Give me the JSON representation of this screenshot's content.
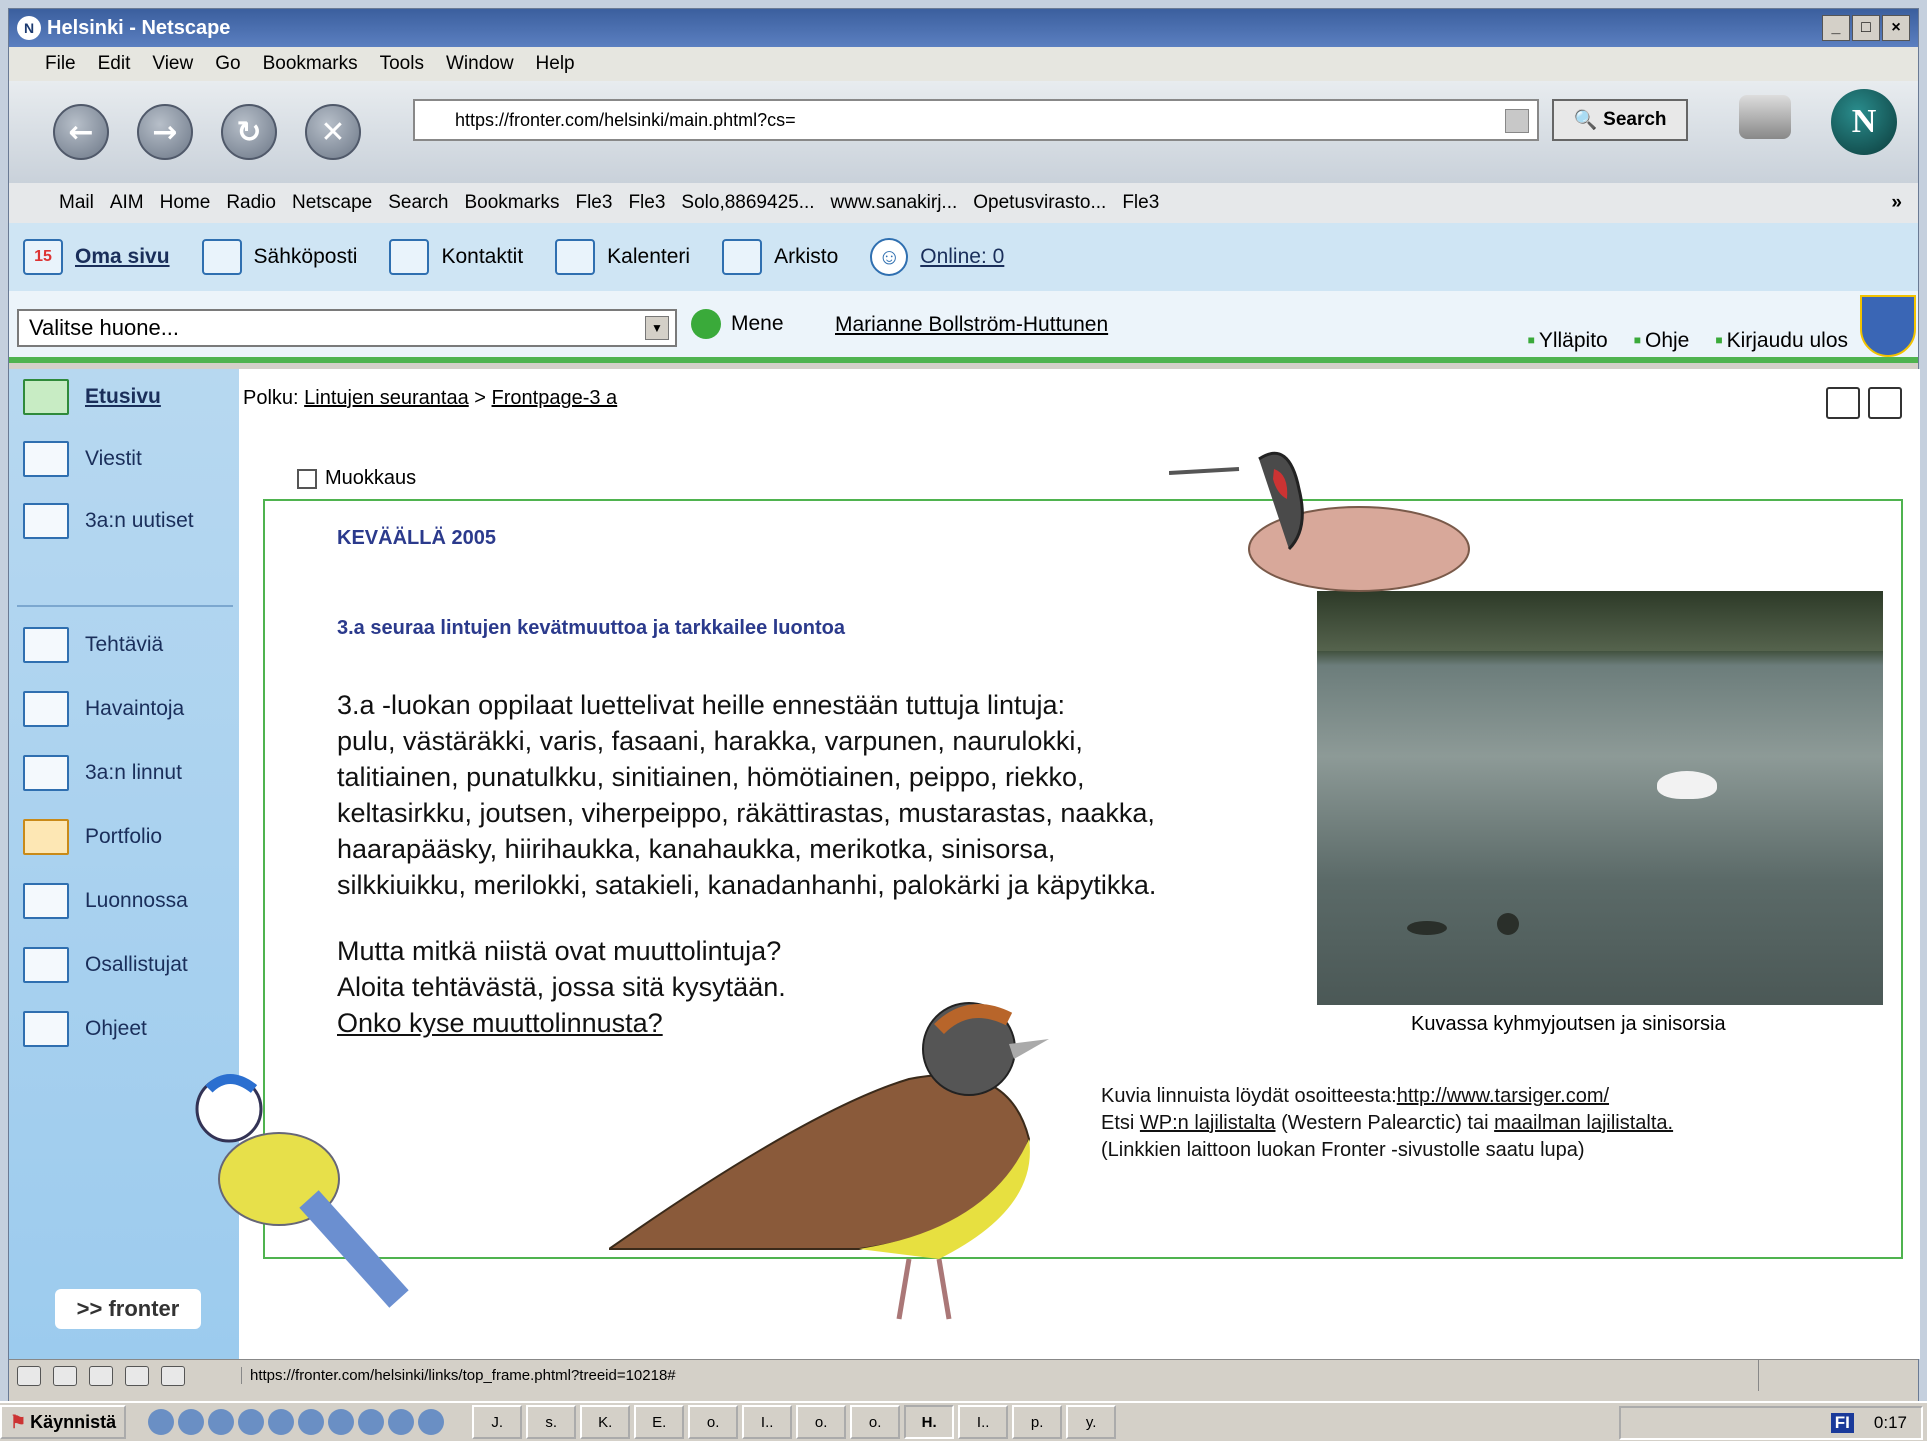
{
  "window": {
    "title": "Helsinki - Netscape"
  },
  "menu": [
    "File",
    "Edit",
    "View",
    "Go",
    "Bookmarks",
    "Tools",
    "Window",
    "Help"
  ],
  "nav": {
    "url": "https://fronter.com/helsinki/main.phtml?cs=",
    "search_label": "Search",
    "logo_letter": "N"
  },
  "bookmarks": [
    "Mail",
    "AIM",
    "Home",
    "Radio",
    "Netscape",
    "Search",
    "Bookmarks",
    "Fle3",
    "Fle3",
    "Solo,8869425...",
    "www.sanakirj...",
    "Opetusvirasto...",
    "Fle3"
  ],
  "fronter_bar": {
    "oma_sivu": "Oma sivu",
    "sahkoposti": "Sähköposti",
    "kontaktit": "Kontaktit",
    "kalenteri": "Kalenteri",
    "arkisto": "Arkisto",
    "online": "Online: 0",
    "calendar_day": "15"
  },
  "room_bar": {
    "room_placeholder": "Valitse huone...",
    "go_label": "Mene",
    "user": "Marianne Bollström-Huttunen",
    "yllapito": "Ylläpito",
    "ohje": "Ohje",
    "kirjaudu_ulos": "Kirjaudu ulos"
  },
  "sidebar": {
    "items": [
      "Etusivu",
      "Viestit",
      "3a:n uutiset",
      "Tehtäviä",
      "Havaintoja",
      "3a:n linnut",
      "Portfolio",
      "Luonnossa",
      "Osallistujat",
      "Ohjeet"
    ],
    "logo": ">> fronter"
  },
  "breadcrumb": {
    "label": "Polku:",
    "crumb1": "Lintujen seurantaa",
    "sep": ">",
    "crumb2": "Frontpage-3 a"
  },
  "page": {
    "edit_label": "Muokkaus",
    "heading": "KEVÄÄLLÄ 2005",
    "subheading": "3.a seuraa lintujen kevätmuuttoa ja tarkkailee luontoa",
    "body_lines": [
      "3.a -luokan oppilaat luettelivat heille ennestään tuttuja lintuja:",
      "pulu, västäräkki, varis, fasaani, harakka, varpunen, naurulokki,",
      "talitiainen, punatulkku, sinitiainen, hömötiainen, peippo, riekko,",
      "keltasirkku, joutsen, viherpeippo, räkättirastas, mustarastas, naakka,",
      "haarapääsky, hiirihaukka, kanahaukka, merikotka, sinisorsa,",
      "silkkiuikku, merilokki, satakieli, kanadanhanhi, palokärki ja käpytikka."
    ],
    "question1": "Mutta mitkä niistä ovat muuttolintuja?",
    "question2": "Aloita tehtävästä, jossa sitä kysytään.",
    "question_link": "Onko kyse muuttolinnusta?",
    "photo_caption": "Kuvassa kyhmyjoutsen ja sinisorsia",
    "info1_prefix": "Kuvia linnuista löydät osoitteesta:",
    "info1_link": "http://www.tarsiger.com/",
    "info2_prefix": "Etsi",
    "info2_link1": "WP:n lajilistalta",
    "info2_mid": "(Western Palearctic) tai",
    "info2_link2": "maailman lajilistalta.",
    "info3": "(Linkkien laittoon luokan Fronter -sivustolle saatu lupa)"
  },
  "status": {
    "url": "https://fronter.com/helsinki/links/top_frame.phtml?treeid=10218#"
  },
  "taskbar": {
    "start": "Käynnistä",
    "buttons": [
      "J.",
      "s.",
      "K.",
      "E.",
      "o.",
      "I..",
      "o.",
      "o.",
      "H.",
      "I..",
      "p.",
      "y."
    ],
    "clock": "0:17",
    "lang": "FI"
  }
}
